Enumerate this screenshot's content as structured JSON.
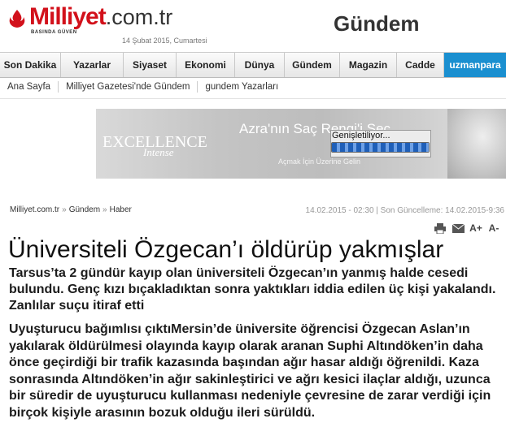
{
  "header": {
    "logo_brand": "Milliyet",
    "logo_domain": ".com.tr",
    "logo_slogan": "BASINDA GÜVEN",
    "date": "14 Şubat 2015, Cumartesi",
    "section_title": "Gündem"
  },
  "nav": {
    "items": [
      {
        "label": "Son Dakika"
      },
      {
        "label": "Yazarlar"
      },
      {
        "label": "Siyaset"
      },
      {
        "label": "Ekonomi"
      },
      {
        "label": "Dünya"
      },
      {
        "label": "Gündem"
      },
      {
        "label": "Magazin"
      },
      {
        "label": "Cadde"
      },
      {
        "label": "uzmanpara"
      }
    ]
  },
  "subnav": {
    "items": [
      {
        "label": "Ana Sayfa"
      },
      {
        "label": "Milliyet Gazetesi'nde Gündem"
      },
      {
        "label": "gundem Yazarları"
      }
    ]
  },
  "banner": {
    "brand": "EXCELLENCE",
    "brand_sub": "Intense",
    "headline": "Azra'nın Saç Rengi'i Seç",
    "hint": "Açmak İçin Üzerine Gelin",
    "loading_label": "Genişletiliyor...",
    "progress": 1.0
  },
  "breadcrumb": {
    "site": "Milliyet.com.tr",
    "section": "Gündem",
    "page": "Haber"
  },
  "meta": {
    "text": "14.02.2015 - 02:30 | Son Güncelleme: 14.02.2015-9:36"
  },
  "tools": {
    "font_up": "A+",
    "font_down": "A-"
  },
  "article": {
    "headline": "Üniversiteli Özgecan’ı öldürüp yakmışlar",
    "summary": "Tarsus’ta 2 gündür kayıp olan üniversiteli Özgecan’ın yanmış halde cesedi bulundu. Genç kızı bıçakladıktan sonra yaktıkları iddia edilen üç kişi yakalandı. Zanlılar suçu itiraf etti",
    "body": "Uyuşturucu bağımlısı çıktıMersin’de üniversite öğrencisi Özgecan Aslan’ın yakılarak öldürülmesi olayında kayıp olarak aranan Suphi Altındöken’in daha önce geçirdiği bir trafik kazasında başından ağır hasar aldığı öğrenildi. Kaza sonrasında Altındöken’in ağır sakinleştirici ve ağrı kesici ilaçlar aldığı, uzunca bir süredir de uyuşturucu kullanması nedeniyle çevresine de zarar verdiği için birçok kişiyle arasının bozuk olduğu ileri sürüldü."
  },
  "colors": {
    "brand_red": "#d2111b",
    "uzmanpara_blue": "#1a8fd0"
  }
}
